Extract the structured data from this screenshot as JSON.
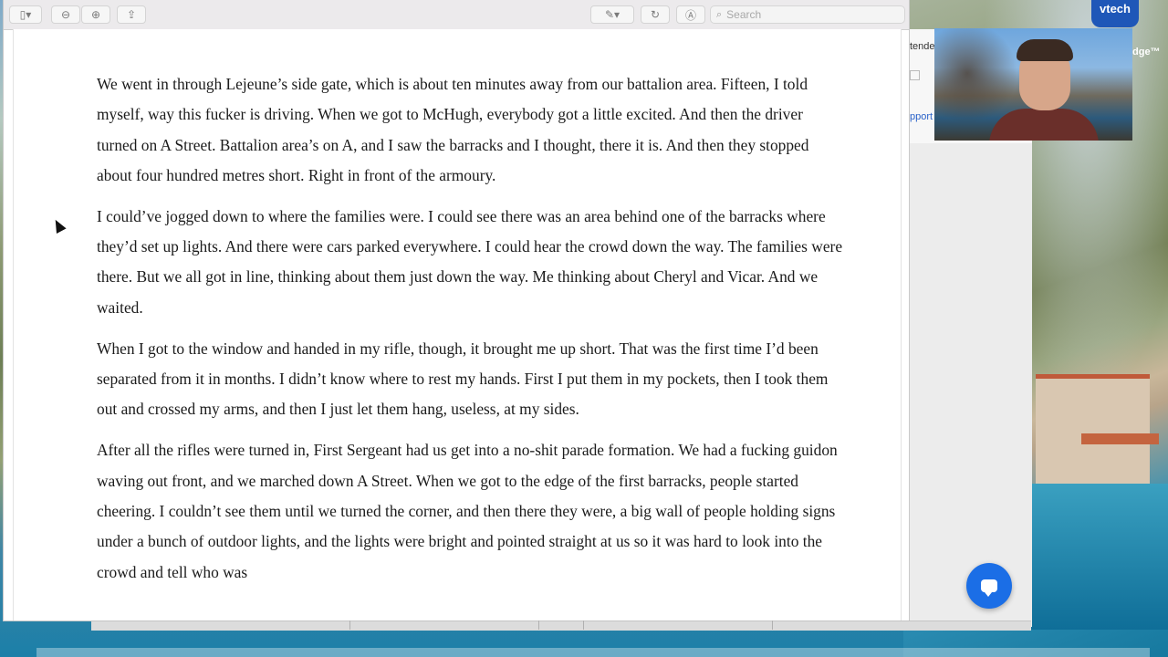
{
  "toolbar": {
    "search_placeholder": "Search",
    "icons": [
      "sidebar-icon",
      "zoom-out-icon",
      "zoom-in-icon",
      "share-icon",
      "markup-pen-icon",
      "rotate-icon",
      "annotate-icon",
      "search-icon"
    ]
  },
  "document": {
    "paragraphs": [
      "We went in through Lejeune’s side gate, which is about ten minutes away from our battalion area. Fifteen, I told myself, way this fucker is driving. When we got to McHugh, everybody got a little excited. And then the driver turned on A Street. Battalion area’s on A, and I saw the barracks and I thought, there it is. And then they stopped about four hundred metres short. Right in front of the armoury.",
      "I could’ve jogged down to where the families were. I could see there was an area behind one of the barracks where they’d set up lights. And there were cars parked everywhere. I could hear the crowd down the way. The families were there. But we all got in line, thinking about them just down the way. Me thinking about Cheryl and Vicar. And we waited.",
      "When I got to the window and handed in my rifle, though, it brought me up short. That was the first time I’d been separated from it in months. I didn’t know where to rest my hands. First I put them in my pockets, then I took them out and crossed my arms, and then I just let them hang, useless, at my sides.",
      "After all the rifles were turned in, First Sergeant had us get into a no-shit parade formation. We had a fucking guidon waving out front, and we marched down A Street. When we got to the edge of the first barracks, people started cheering. I couldn’t see them until we turned the corner, and then there they were, a big wall of people holding signs under a bunch of outdoor lights, and the lights were bright and pointed straight at us so it was hard to look into the crowd and tell who was"
    ]
  },
  "back_window": {
    "text_top": "tende",
    "link": "pport"
  },
  "overlay": {
    "brand": "vtech",
    "partial_label": "dge™"
  },
  "colors": {
    "accent": "#1b6ee6",
    "brand_blue": "#1f57b8"
  }
}
